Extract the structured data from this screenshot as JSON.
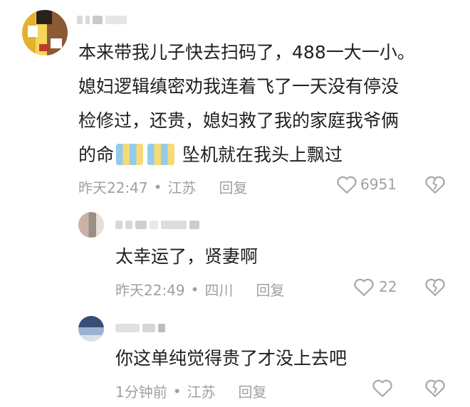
{
  "comments": [
    {
      "lines": [
        "本来带我儿子快去扫码了，488一大一小。",
        "媳妇逻辑缜密劝我连着飞了一天没有停没",
        "检修过，还贵，媳妇救了我的家庭我爷俩",
        "的命"
      ],
      "line4_tail": "坠机就在我头上飘过",
      "time": "昨天22:47",
      "location": "江苏",
      "reply": "回复",
      "likes": "6951"
    },
    {
      "text": "太幸运了，贤妻啊",
      "time": "昨天22:49",
      "location": "四川",
      "reply": "回复",
      "likes": "22"
    },
    {
      "text": "你这单纯觉得贵了才没上去吧",
      "time": "1分钟前",
      "location": "江苏",
      "reply": "回复",
      "likes": ""
    }
  ],
  "separator": "•",
  "colors": {
    "meta": "#a0a0a0",
    "text": "#1f1f1f",
    "icon": "#b0b0b0"
  }
}
